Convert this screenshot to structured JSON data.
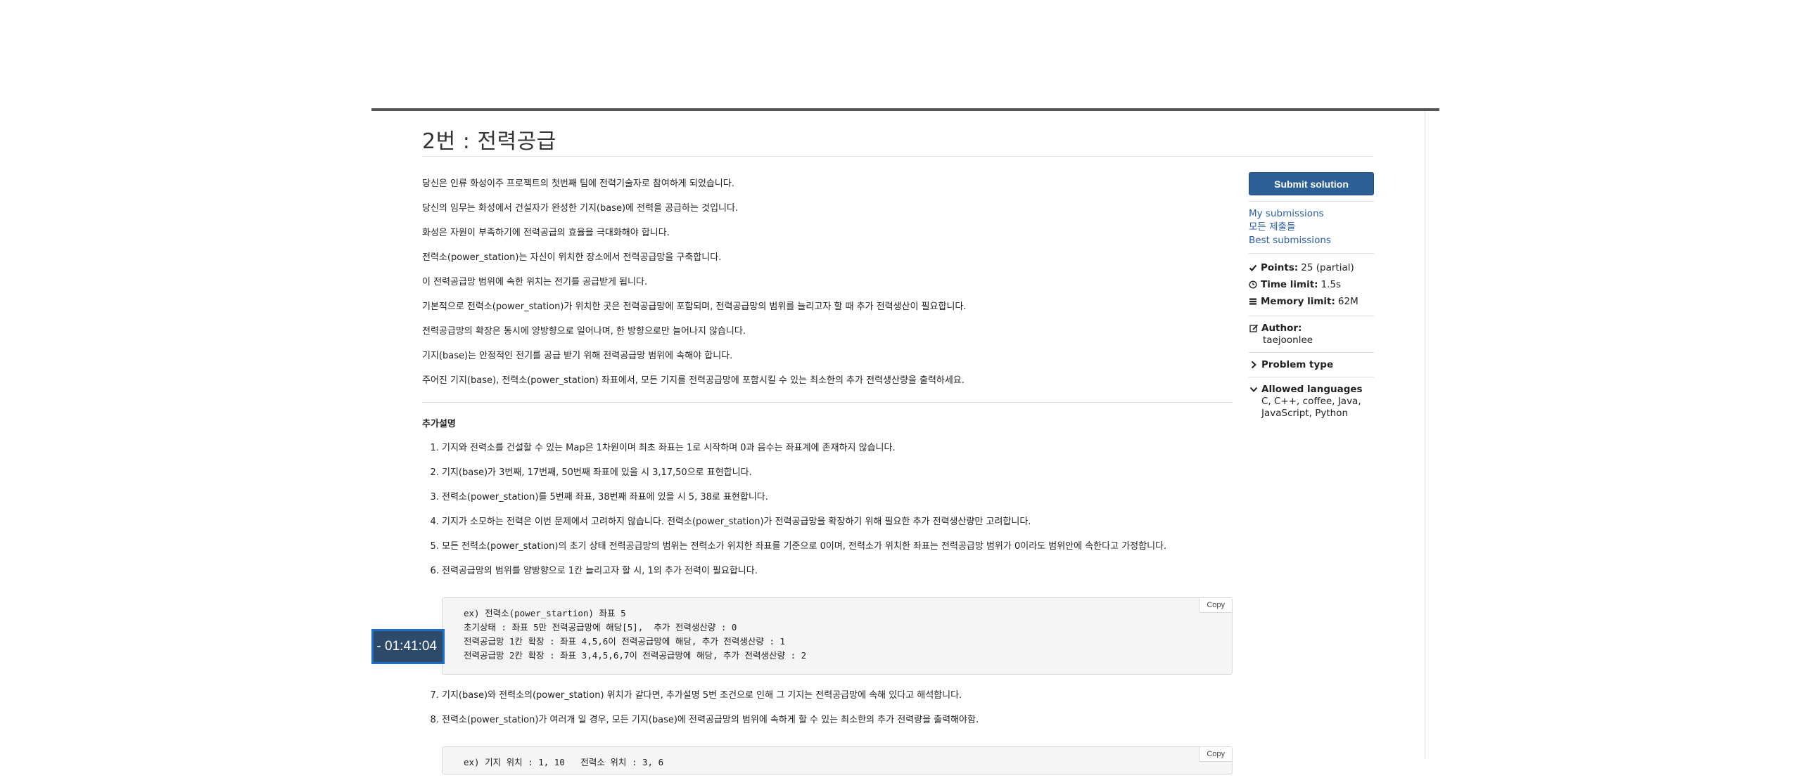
{
  "problem": {
    "title": "2번 : 전력공급",
    "statement": [
      "당신은 인류 화성이주 프로젝트의 첫번째 팀에 전력기술자로 참여하게 되었습니다.",
      "당신의 임무는 화성에서 건설자가 완성한 기지(base)에 전력을 공급하는 것입니다.",
      "화성은 자원이 부족하기에 전력공급의 효율을 극대화해야 합니다.",
      "전력소(power_station)는 자신이 위치한 장소에서 전력공급망을 구축합니다.",
      "이 전력공급망 범위에 속한 위치는 전기를 공급받게 됩니다.",
      "기본적으로 전력소(power_station)가 위치한 곳은 전력공급망에 포함되며, 전력공급망의 범위를 늘리고자 할 때 추가 전력생산이 필요합니다.",
      "전력공급망의 확장은 동시에 양방향으로 일어나며, 한 방향으로만 늘어나지 않습니다.",
      "기지(base)는 안정적인 전기를 공급 받기 위해 전력공급망 범위에 속해야 합니다.",
      "주어진 기지(base), 전력소(power_station) 좌표에서, 모든 기지를 전력공급망에 포함시킬 수 있는 최소한의 추가 전력생산량을 출력하세요."
    ],
    "notes_title": "추가설명",
    "notes": [
      "기지와 전력소를 건설할 수 있는 Map은 1차원이며 최초 좌표는 1로 시작하며 0과 음수는 좌표계에 존재하지 않습니다.",
      "기지(base)가 3번째, 17번째, 50번째 좌표에 있을 시 3,17,50으로 표현합니다.",
      "전력소(power_station)를 5번째 좌표, 38번째 좌표에 있을 시 5, 38로 표현합니다.",
      "기지가 소모하는 전력은 이번 문제에서 고려하지 않습니다. 전력소(power_station)가 전력공급망을 확장하기 위해 필요한 추가 전력생산량만 고려합니다.",
      "모든 전력소(power_station)의 초기 상태 전력공급망의 범위는 전력소가 위치한 좌표를 기준으로 0이며, 전력소가 위치한 좌표는 전력공급망 범위가 0이라도 범위안에 속한다고 가정합니다.",
      "전력공급망의 범위를 양방향으로 1칸 늘리고자 할 시, 1의 추가 전력이 필요합니다."
    ],
    "code_example_1": "ex) 전력소(power_startion) 좌표 5\n초기상태 : 좌표 5만 전력공급망에 해당[5],  추가 전력생산량 : 0\n전력공급망 1칸 확장 : 좌표 4,5,6이 전력공급망에 해당, 추가 전력생산량 : 1\n전력공급망 2칸 확장 : 좌표 3,4,5,6,7이 전력공급망에 해당, 추가 전력생산량 : 2",
    "notes_continued": [
      "기지(base)와 전력소의(power_station) 위치가 같다면, 추가설명 5번 조건으로 인해 그 기지는 전력공급망에 속해 있다고 해석합니다.",
      "전력소(power_station)가 여러개 일 경우, 모든 기지(base)에 전력공급망의 범위에 속하게 할 수 있는 최소한의 추가 전력량을 출력해야함."
    ],
    "code_example_2": "ex) 기지 위치 : 1, 10   전력소 위치 : 3, 6",
    "copy_label": "Copy"
  },
  "sidebar": {
    "submit_label": "Submit solution",
    "links": [
      "My submissions",
      "모든 제출들",
      "Best submissions"
    ],
    "points_label": "Points:",
    "points_value": "25 (partial)",
    "time_label": "Time limit:",
    "time_value": "1.5s",
    "memory_label": "Memory limit:",
    "memory_value": "62M",
    "author_label": "Author:",
    "author_value": "taejoonlee",
    "problem_type_label": "Problem type",
    "languages_label": "Allowed languages",
    "languages_value": "C, C++, coffee, Java, JavaScript, Python"
  },
  "timer": {
    "value": "- 01:41:04"
  }
}
